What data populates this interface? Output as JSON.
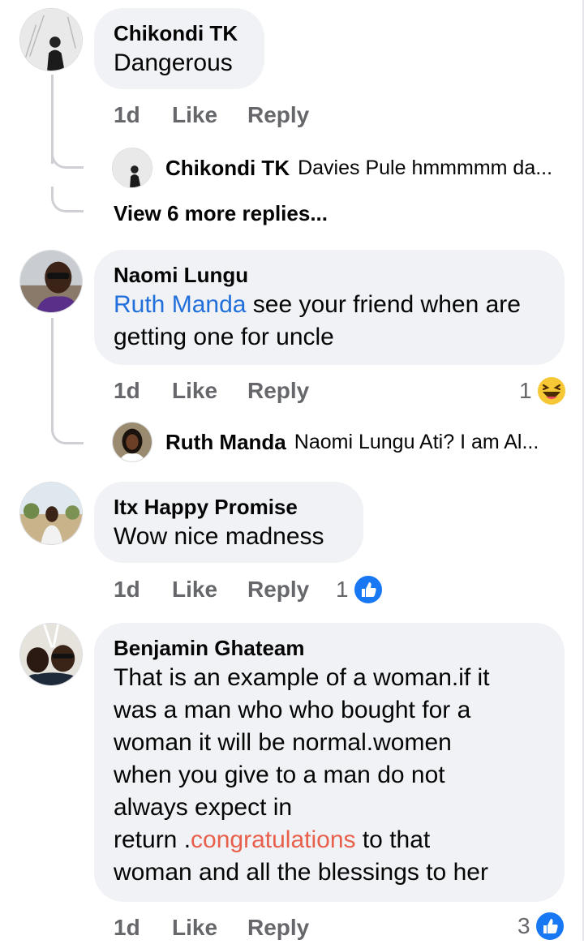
{
  "comments": [
    {
      "author": "Chikondi TK",
      "lines": [
        "Dangerous"
      ],
      "actions": {
        "time": "1d",
        "like": "Like",
        "reply": "Reply"
      },
      "reply_preview": {
        "author": "Chikondi TK",
        "text": "Davies Pule hmmmmm da..."
      },
      "view_more": "View 6 more replies..."
    },
    {
      "author": "Naomi Lungu",
      "mention": "Ruth Manda",
      "lines": [
        " see your friend when are",
        "getting one for uncle"
      ],
      "actions": {
        "time": "1d",
        "like": "Like",
        "reply": "Reply"
      },
      "reaction": {
        "count": "1",
        "icon": "haha-reaction-icon"
      },
      "reply_preview": {
        "author": "Ruth Manda",
        "text": "Naomi Lungu Ati? I am Al..."
      }
    },
    {
      "author": "Itx Happy Promise",
      "lines": [
        "Wow nice madness"
      ],
      "actions": {
        "time": "1d",
        "like": "Like",
        "reply": "Reply"
      },
      "reaction": {
        "count": "1",
        "icon": "like-reaction-icon"
      }
    },
    {
      "author": "Benjamin Ghateam",
      "lines": [
        "That is an example of a woman.if it",
        "was a man who who bought for a",
        "woman it will be normal.women",
        "when you give to a man do not",
        "always expect in"
      ],
      "line6_pre": "return .",
      "line6_highlight": "congratulations",
      "line6_post": " to that",
      "line7": "woman and all the blessings to her",
      "actions": {
        "time": "1d",
        "like": "Like",
        "reply": "Reply"
      },
      "reaction": {
        "count": "3",
        "icon": "like-reaction-icon"
      }
    }
  ],
  "colors": {
    "bubble": "#f0f2f5",
    "mention": "#216fdb",
    "highlight": "#e8604c",
    "meta": "#65676b",
    "like_blue": "#1877f2",
    "haha_yellow": "#f7c836"
  }
}
